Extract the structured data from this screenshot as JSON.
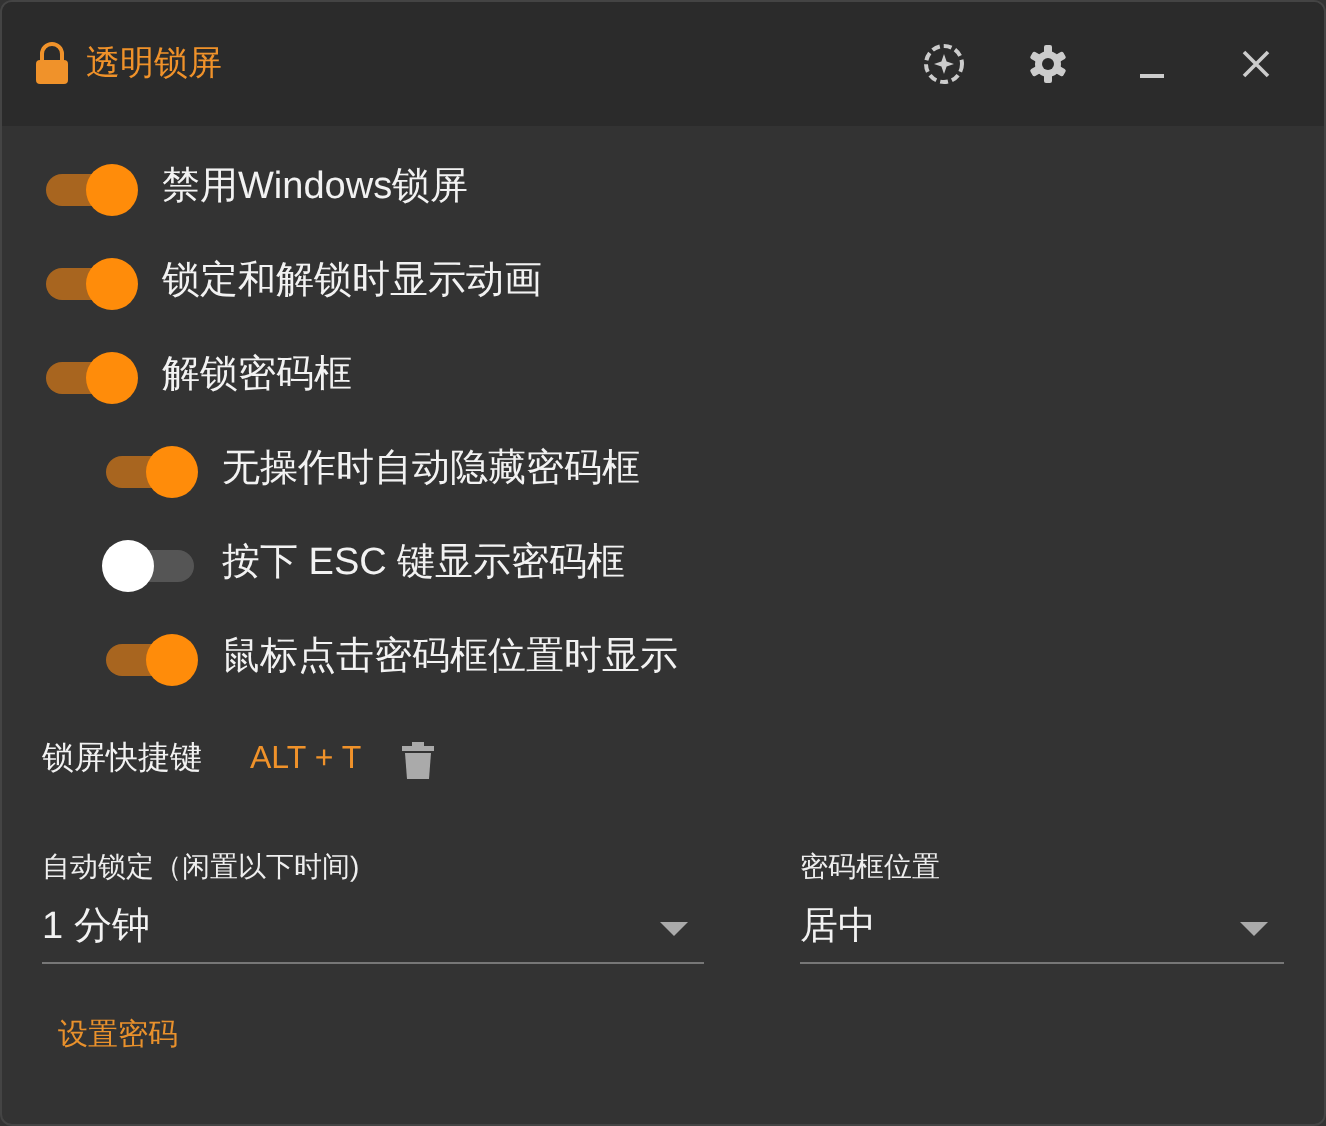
{
  "window": {
    "title": "透明锁屏"
  },
  "toggles": [
    {
      "label": "禁用Windows锁屏",
      "on": true
    },
    {
      "label": "锁定和解锁时显示动画",
      "on": true
    },
    {
      "label": "解锁密码框",
      "on": true,
      "children": [
        {
          "label": "无操作时自动隐藏密码框",
          "on": true
        },
        {
          "label": "按下 ESC 键显示密码框",
          "on": false
        },
        {
          "label": "鼠标点击密码框位置时显示",
          "on": true
        }
      ]
    }
  ],
  "hotkey": {
    "label": "锁屏快捷键",
    "value": "ALT + T"
  },
  "selects": [
    {
      "label": "自动锁定（闲置以下时间)",
      "value": "1 分钟"
    },
    {
      "label": "密码框位置",
      "value": "居中"
    }
  ],
  "link": "设置密码"
}
